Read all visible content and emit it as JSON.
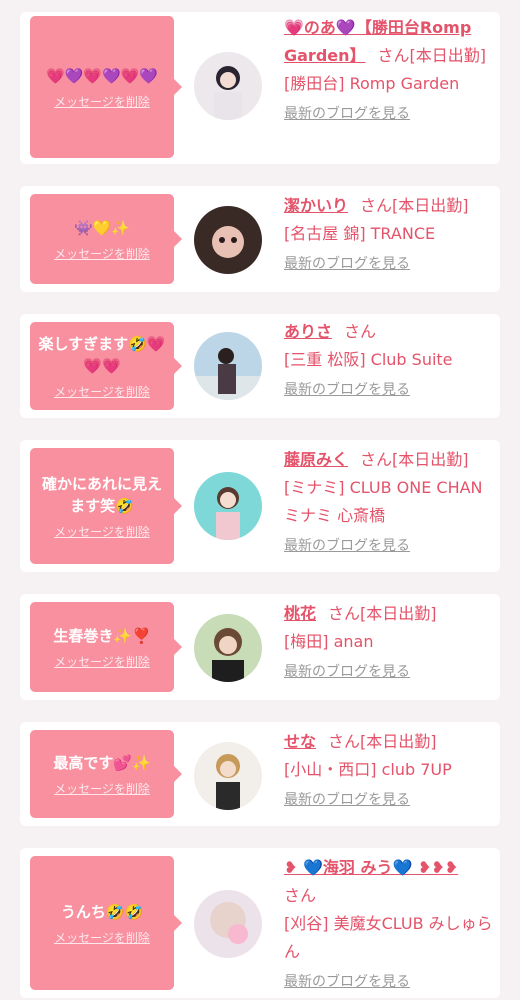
{
  "delete_label": "メッセージを削除",
  "blog_label": "最新のブログを見る",
  "cards": [
    {
      "message": "💗💜💗💜💗💜",
      "name": "💗のあ💜【勝田台Romp Garden】",
      "suffix": "さん[本日出勤]",
      "store": "[勝田台] Romp Garden"
    },
    {
      "message": "👾💛✨",
      "name": "潔かいり",
      "suffix": "さん[本日出勤]",
      "store": "[名古屋 錦] TRANCE"
    },
    {
      "message": "楽しすぎます🤣💗💗💗",
      "name": "ありさ",
      "suffix": "さん",
      "store": "[三重 松阪] Club Suite"
    },
    {
      "message": "確かにあれに見えます笑🤣",
      "name": "藤原みく",
      "suffix": "さん[本日出勤]",
      "store": "[ミナミ] CLUB ONE CHAN ミナミ 心斎橋"
    },
    {
      "message": "生春巻き✨❣️",
      "name": "桃花",
      "suffix": "さん[本日出勤]",
      "store": "[梅田] anan"
    },
    {
      "message": "最高です💕✨",
      "name": "せな",
      "suffix": "さん[本日出勤]",
      "store": "[小山・西口] club 7UP"
    },
    {
      "message": "うんち🤣🤣",
      "name": "❥ 💙海羽 みう💙 ❥❥❥",
      "suffix": "さん",
      "store": "[刈谷] 美魔女CLUB みしゅらん"
    }
  ]
}
